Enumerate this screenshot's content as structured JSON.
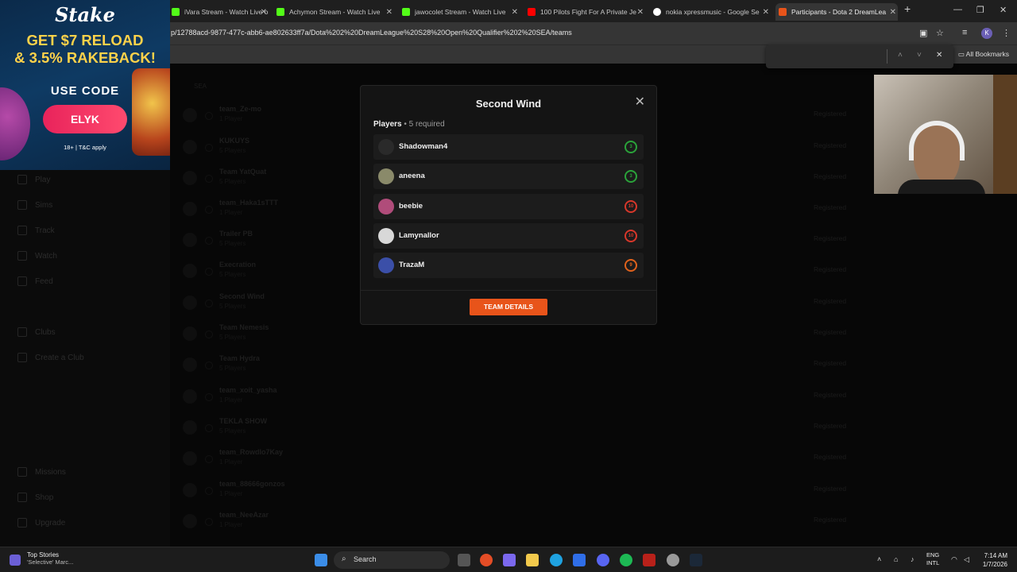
{
  "browser": {
    "tabs": [
      {
        "label": "iVara Stream - Watch Live on",
        "favicon_color": "#53fc18"
      },
      {
        "label": "Achymon Stream - Watch Live",
        "favicon_color": "#53fc18"
      },
      {
        "label": "jawocolet Stream - Watch Live",
        "favicon_color": "#53fc18"
      },
      {
        "label": "100 Pilots Fight For A Private Je",
        "favicon_color": "#ff0000"
      },
      {
        "label": "nokia xpressmusic - Google Se",
        "favicon_color": "#ffffff"
      },
      {
        "label": "Participants - Dota 2 DreamLea",
        "favicon_color": "#e8541a"
      }
    ],
    "url": "p/12788acd-9877-477c-abb6-ae802633ff7a/Dota%202%20DreamLeague%20S28%20Open%20Qualifier%202%20SEA/teams",
    "bookmarks_label": "All Bookmarks",
    "profile_initial": "K"
  },
  "ad": {
    "brand": "Stake",
    "headline_1": "GET $7 RELOAD",
    "headline_2": "& 3.5% RAKEBACK!",
    "use_code": "USE CODE",
    "code": "ELYK",
    "terms": "18+ | T&C apply"
  },
  "sidebar": {
    "items": [
      {
        "label": "Play"
      },
      {
        "label": "Sims"
      },
      {
        "label": "Track"
      },
      {
        "label": "Watch"
      },
      {
        "label": "Feed"
      },
      {
        "label": "Clubs"
      },
      {
        "label": "Create a Club"
      },
      {
        "label": "Missions"
      },
      {
        "label": "Shop"
      },
      {
        "label": "Upgrade"
      }
    ]
  },
  "region_label": "SEA",
  "teams": [
    {
      "name": "team_Ze-mo",
      "count": "1 Player",
      "status": "Registered"
    },
    {
      "name": "KUKUYS",
      "count": "5 Players",
      "status": "Registered"
    },
    {
      "name": "Team YatQuat",
      "count": "5 Players",
      "status": "Registered"
    },
    {
      "name": "team_Haka1sTTT",
      "count": "1 Player",
      "status": "Registered"
    },
    {
      "name": "Trailer PB",
      "count": "5 Players",
      "status": "Registered"
    },
    {
      "name": "Execration",
      "count": "5 Players",
      "status": "Registered"
    },
    {
      "name": "Second Wind",
      "count": "5 Players",
      "status": "Registered"
    },
    {
      "name": "Team Nemesis",
      "count": "5 Players",
      "status": "Registered"
    },
    {
      "name": "Team Hydra",
      "count": "5 Players",
      "status": "Registered"
    },
    {
      "name": "team_xoit_yasha",
      "count": "1 Player",
      "status": "Registered"
    },
    {
      "name": "TEKLA SHOW",
      "count": "5 Players",
      "status": "Registered"
    },
    {
      "name": "team_RowdIo7Kay",
      "count": "1 Player",
      "status": "Registered"
    },
    {
      "name": "team_88666gonzos",
      "count": "1 Player",
      "status": "Registered"
    },
    {
      "name": "team_NeeAzar",
      "count": "1 Player",
      "status": "Registered"
    }
  ],
  "modal": {
    "title": "Second Wind",
    "players_label": "Players",
    "required_label": "• 5 required",
    "players": [
      {
        "name": "Shadowman4",
        "rank": "3",
        "rank_color": "green"
      },
      {
        "name": "aneena",
        "rank": "3",
        "rank_color": "green"
      },
      {
        "name": "beebie",
        "rank": "10",
        "rank_color": "red"
      },
      {
        "name": "Lamynallor",
        "rank": "10",
        "rank_color": "red"
      },
      {
        "name": "TrazaM",
        "rank": "9",
        "rank_color": "orange"
      }
    ],
    "button_label": "TEAM DETAILS"
  },
  "taskbar": {
    "news_title": "Top Stories",
    "news_subtitle": "'Selective' Marc...",
    "search_label": "Search",
    "lang_1": "ENG",
    "lang_2": "INTL",
    "time": "7:14 AM",
    "date": "1/7/2026"
  },
  "colors": {
    "accent": "#e8541a",
    "rank_green": "#2aa33a",
    "rank_red": "#d8372a",
    "rank_orange": "#e0621c"
  }
}
